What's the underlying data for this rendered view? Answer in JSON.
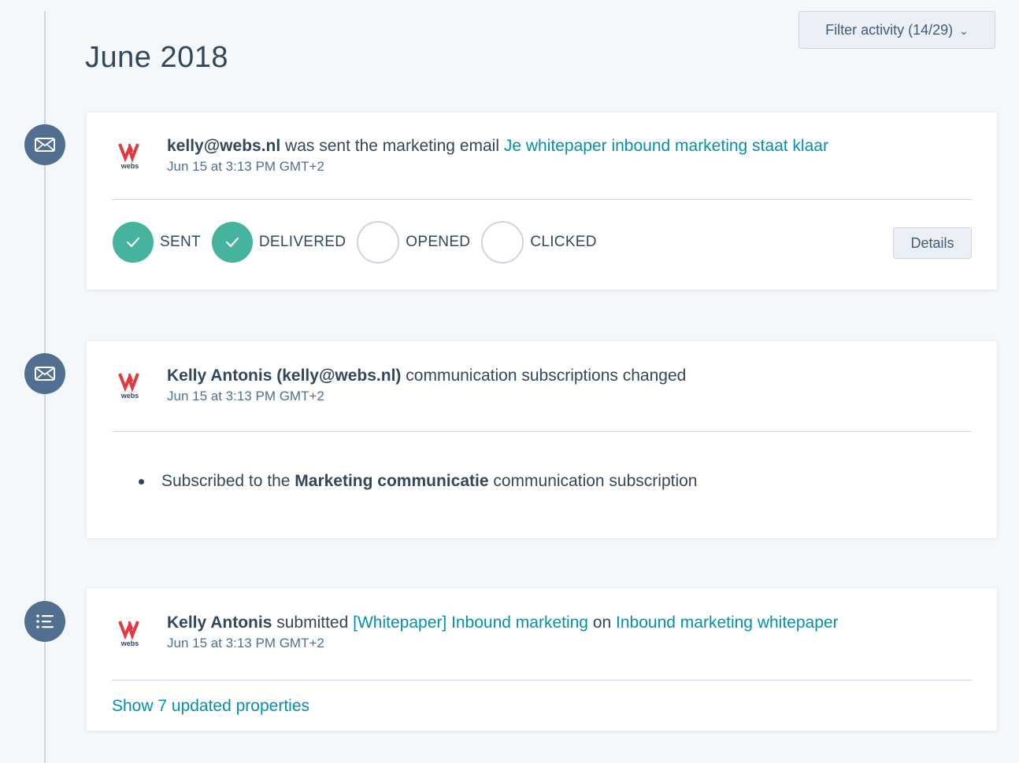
{
  "filter": {
    "label": "Filter activity (14/29)",
    "chevron": "⌄"
  },
  "month": "June 2018",
  "logo": {
    "name": "webs-logo",
    "text": "webs",
    "color": "#e03a3e"
  },
  "colors": {
    "accent_link": "#0091ae",
    "success": "#45b39e",
    "node": "#516f90"
  },
  "activities": {
    "email": {
      "icon": "envelope-icon",
      "actor": "kelly@webs.nl",
      "action": "was sent the marketing email",
      "email_link": "Je whitepaper inbound marketing staat klaar",
      "timestamp": "Jun 15 at 3:13 PM GMT+2",
      "statuses": [
        {
          "label": "SENT",
          "done": true
        },
        {
          "label": "DELIVERED",
          "done": true
        },
        {
          "label": "OPENED",
          "done": false
        },
        {
          "label": "CLICKED",
          "done": false
        }
      ],
      "details_label": "Details"
    },
    "subscription": {
      "icon": "envelope-icon",
      "actor": "Kelly Antonis (kelly@webs.nl)",
      "action": "communication subscriptions changed",
      "timestamp": "Jun 15 at 3:13 PM GMT+2",
      "bullet_prefix": "Subscribed to the",
      "bullet_bold": "Marketing communicatie",
      "bullet_suffix": "communication subscription"
    },
    "form": {
      "icon": "form-list-icon",
      "actor": "Kelly Antonis",
      "action": "submitted",
      "form_link": "[Whitepaper] Inbound marketing",
      "on_word": "on",
      "page_link": "Inbound marketing whitepaper",
      "timestamp": "Jun 15 at 3:13 PM GMT+2",
      "show_label": "Show 7 updated properties"
    }
  }
}
